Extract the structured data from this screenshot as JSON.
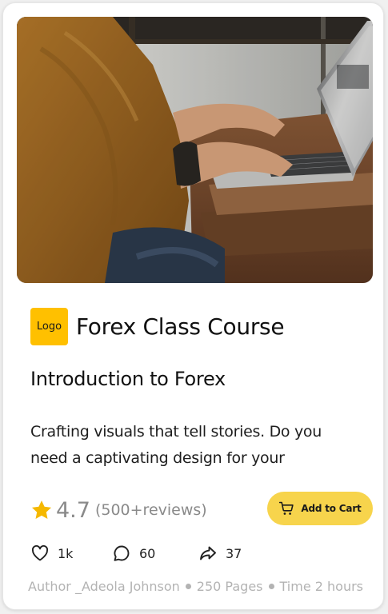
{
  "brand": {
    "logo_text": "Logo",
    "course_title": "Forex Class Course"
  },
  "subtitle": "Introduction to Forex",
  "description": "Crafting visuals that tell stories. Do you need a captivating design for your",
  "rating": {
    "value": "4.7",
    "reviews": "(500+reviews)"
  },
  "cart": {
    "label": "Add to Cart"
  },
  "social": {
    "likes": "1k",
    "comments": "60",
    "shares": "37"
  },
  "meta": {
    "author": "Author _Adeola Johnson",
    "pages": "250 Pages",
    "time": "Time 2 hours"
  },
  "colors": {
    "accent": "#ffc000",
    "button": "#f7d44c",
    "star": "#f5b800",
    "muted": "#b3b3b3"
  },
  "icons": {
    "star": "star-icon",
    "cart": "cart-icon",
    "like": "heart-icon",
    "comment": "comment-icon",
    "share": "share-icon"
  }
}
